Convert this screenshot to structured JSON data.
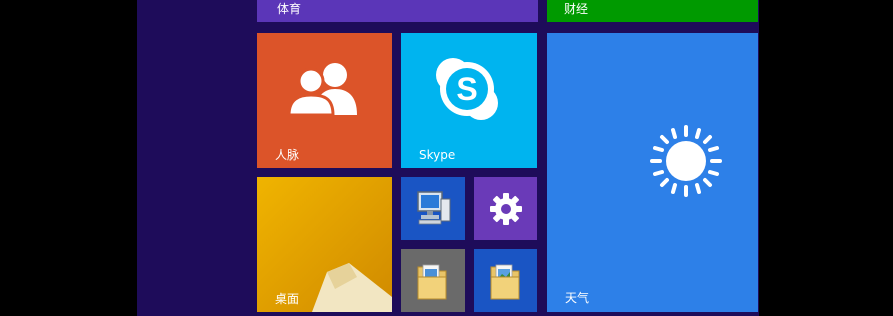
{
  "colors": {
    "background": "#1e0c5a",
    "sports": "#5b36b8",
    "finance": "#009a00",
    "people": "#dc5429",
    "skype": "#00b4ef",
    "weather": "#2d80e8",
    "desktop": "#e0a600",
    "computer": "#1a55c4",
    "settings": "#6a3ab8",
    "files": "#6a6a6a",
    "documents": "#1a55c4"
  },
  "tiles": {
    "sports": {
      "label": "体育"
    },
    "finance": {
      "label": "财经"
    },
    "people": {
      "label": "人脉",
      "icon": "people-icon"
    },
    "skype": {
      "label": "Skype",
      "icon": "skype-icon"
    },
    "weather": {
      "label": "天气",
      "icon": "sun-icon"
    },
    "desktop": {
      "label": "桌面"
    },
    "computer": {
      "icon": "computer-icon"
    },
    "settings": {
      "icon": "gear-icon"
    },
    "files": {
      "icon": "folder-icon"
    },
    "documents": {
      "icon": "folder-icon"
    }
  }
}
